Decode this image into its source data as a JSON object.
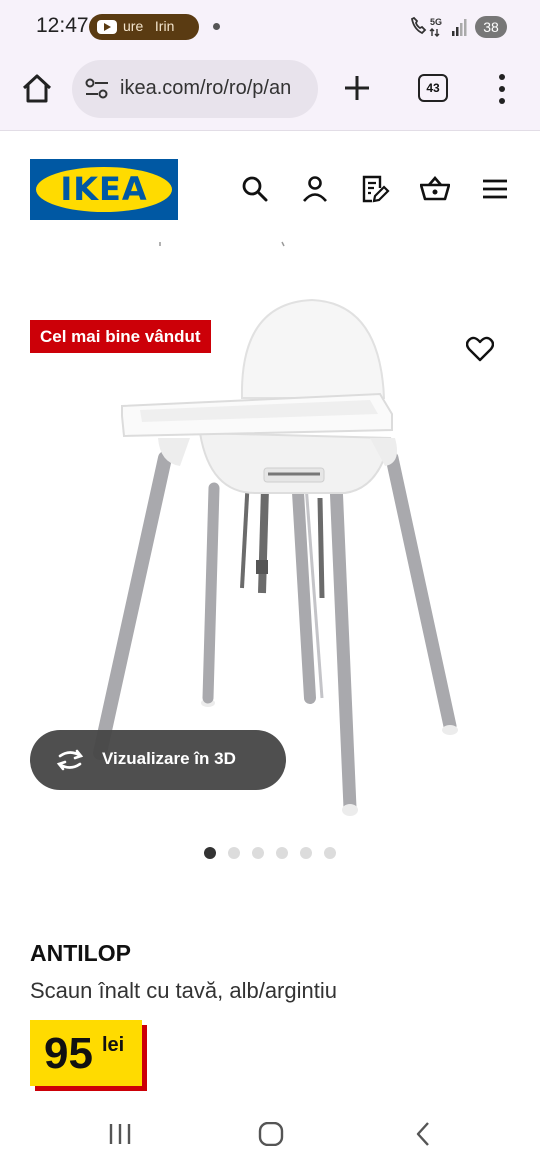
{
  "status_bar": {
    "time": "12:47",
    "media_text": "ure   Irin",
    "signal_text": "5G",
    "battery": "38"
  },
  "browser": {
    "url": "ikea.com/ro/ro/p/an",
    "tab_count": "43"
  },
  "header": {
    "logo_text": "IKEA",
    "icons": [
      "search-icon",
      "account-icon",
      "shopping-list-icon",
      "cart-icon",
      "menu-icon"
    ]
  },
  "product": {
    "badge": "Cel mai bine vândut",
    "view_3d_label": "Vizualizare în 3D",
    "image_count": 6,
    "active_image_index": 0,
    "name": "ANTILOP",
    "description": "Scaun înalt cu tavă, alb/argintiu",
    "price": "95",
    "currency": "lei"
  },
  "colors": {
    "ikea_blue": "#0058a3",
    "ikea_yellow": "#ffdb00",
    "badge_red": "#cc0008"
  }
}
